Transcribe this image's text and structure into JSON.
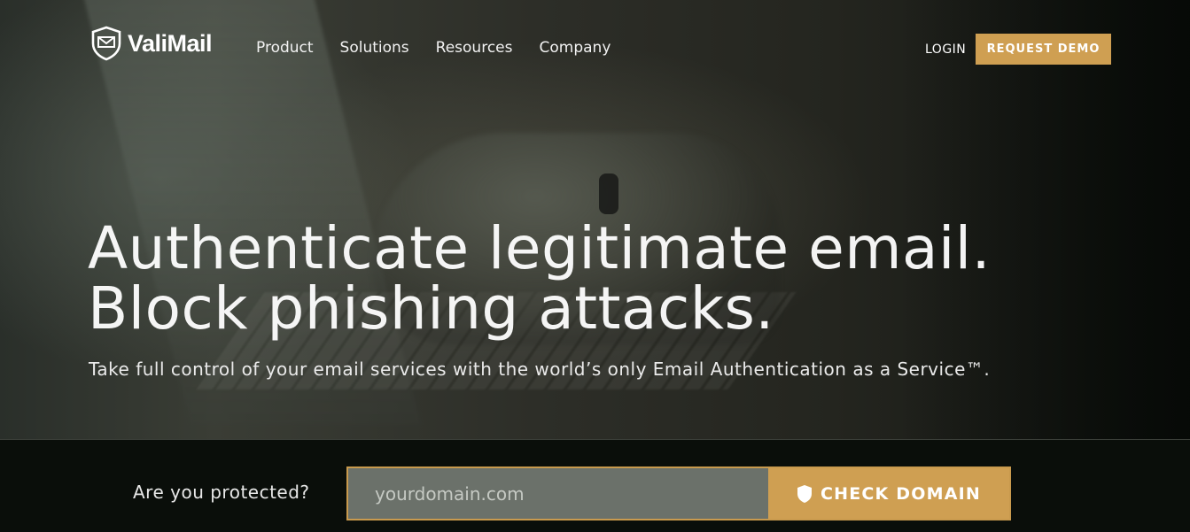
{
  "brand": {
    "name": "ValiMail",
    "logo_icon": "shield-envelope-icon"
  },
  "nav": {
    "links": [
      "Product",
      "Solutions",
      "Resources",
      "Company"
    ],
    "login": "LOGIN",
    "request_demo": "REQUEST DEMO"
  },
  "hero": {
    "headline_line1": "Authenticate legitimate email.",
    "headline_line2": "Block phishing attacks.",
    "subheadline": "Take full control of your email services with the world’s only Email Authentication as a Service™."
  },
  "domain_check": {
    "prompt": "Are you protected?",
    "placeholder": "yourdomain.com",
    "button_label": "CHECK DOMAIN",
    "button_icon": "shield-icon"
  },
  "colors": {
    "accent": "#cf9f52",
    "bar_background": "#0a0e0a",
    "input_background": "#6b716a"
  }
}
